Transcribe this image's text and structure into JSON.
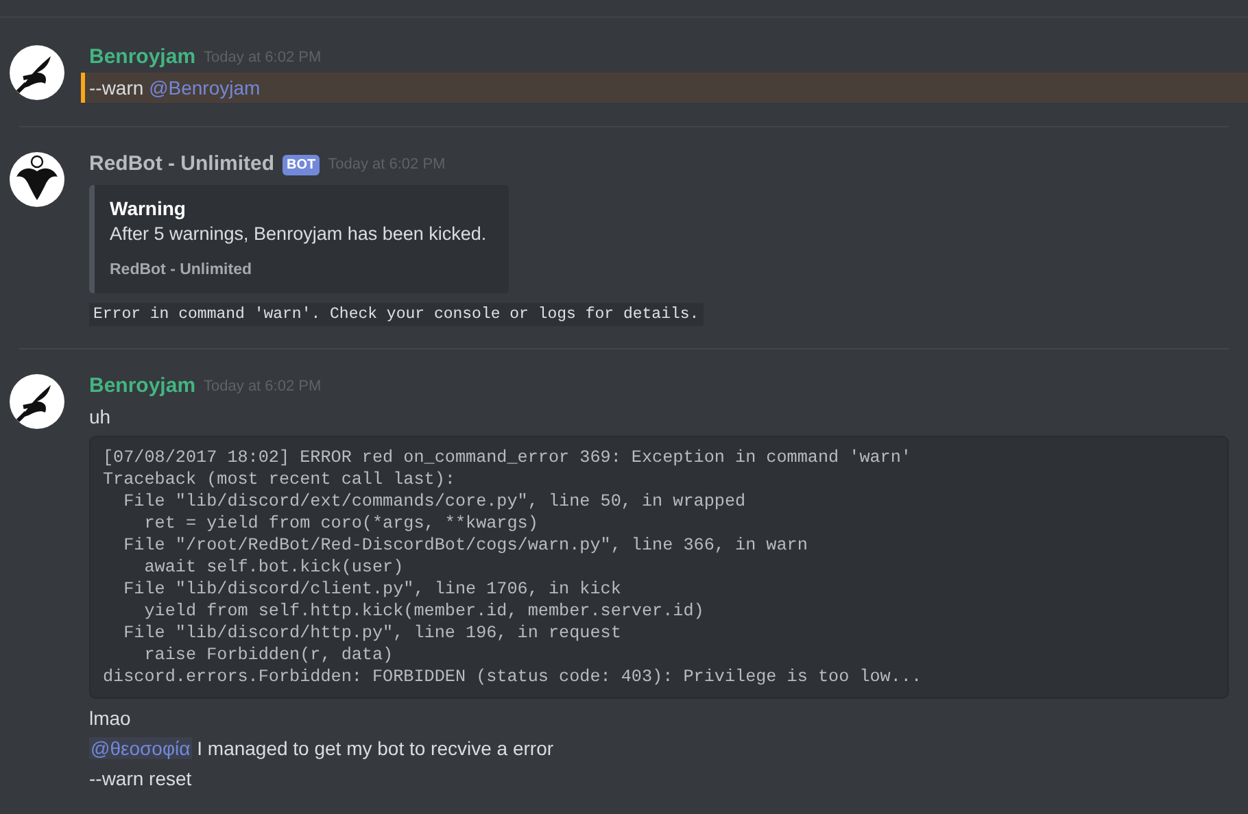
{
  "messages": [
    {
      "author": {
        "kind": "user",
        "name": "Benroyjam",
        "color": "#43b581"
      },
      "timestamp": "Today at 6:02 PM",
      "content": [
        {
          "kind": "text",
          "highlighted": true,
          "parts": [
            {
              "kind": "plain",
              "text": "--warn "
            },
            {
              "kind": "mention",
              "text": "@Benroyjam"
            }
          ]
        }
      ]
    },
    {
      "author": {
        "kind": "bot",
        "name": "RedBot - Unlimited",
        "color": "#b9bbbe",
        "bot_badge": "BOT"
      },
      "timestamp": "Today at 6:02 PM",
      "content": [
        {
          "kind": "embed",
          "title": "Warning",
          "description": "After 5 warnings, Benroyjam has been kicked.",
          "footer": "RedBot - Unlimited"
        },
        {
          "kind": "inline_code",
          "text": "Error in command 'warn'. Check your console or logs for details."
        }
      ]
    },
    {
      "author": {
        "kind": "user",
        "name": "Benroyjam",
        "color": "#43b581"
      },
      "timestamp": "Today at 6:02 PM",
      "content": [
        {
          "kind": "text",
          "highlighted": false,
          "parts": [
            {
              "kind": "plain",
              "text": "uh"
            }
          ]
        },
        {
          "kind": "code_block",
          "lines": [
            "[07/08/2017 18:02] ERROR red on_command_error 369: Exception in command 'warn'",
            "Traceback (most recent call last):",
            "  File \"lib/discord/ext/commands/core.py\", line 50, in wrapped",
            "    ret = yield from coro(*args, **kwargs)",
            "  File \"/root/RedBot/Red-DiscordBot/cogs/warn.py\", line 366, in warn",
            "    await self.bot.kick(user)",
            "  File \"lib/discord/client.py\", line 1706, in kick",
            "    yield from self.http.kick(member.id, member.server.id)",
            "  File \"lib/discord/http.py\", line 196, in request",
            "    raise Forbidden(r, data)",
            "discord.errors.Forbidden: FORBIDDEN (status code: 403): Privilege is too low..."
          ]
        },
        {
          "kind": "text",
          "highlighted": false,
          "parts": [
            {
              "kind": "plain",
              "text": "lmao"
            }
          ]
        },
        {
          "kind": "text",
          "highlighted": false,
          "parts": [
            {
              "kind": "mention",
              "text": "@θεοσοφία"
            },
            {
              "kind": "plain",
              "text": " I managed to get my bot to recvive a error"
            }
          ]
        },
        {
          "kind": "text",
          "highlighted": false,
          "parts": [
            {
              "kind": "plain",
              "text": "--warn reset"
            }
          ]
        }
      ]
    }
  ]
}
